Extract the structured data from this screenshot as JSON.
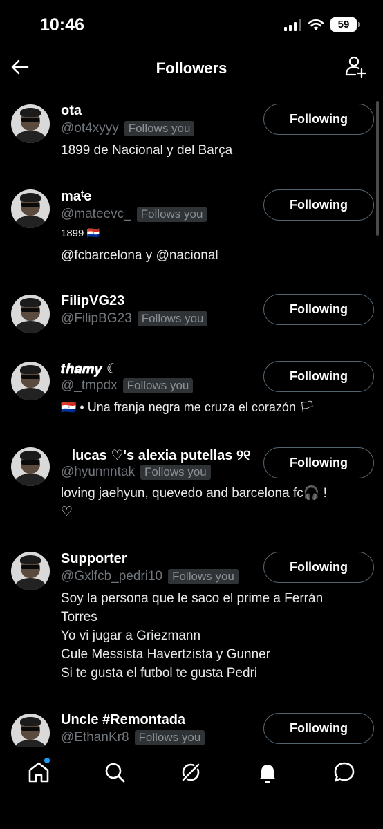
{
  "status": {
    "time": "10:46",
    "battery": "59"
  },
  "header": {
    "title": "Followers"
  },
  "followers": [
    {
      "name": "ota",
      "handle": "@ot4xyyy",
      "badge": "Follows you",
      "bio": [
        "1899 de Nacional y del Barça"
      ],
      "button": "Following"
    },
    {
      "name": "maᵗe",
      "handle": "@mateevc_",
      "badge": "Follows you",
      "bio_small": "1899 🇵🇾",
      "bio": [
        "@fcbarcelona y @nacional"
      ],
      "button": "Following"
    },
    {
      "name": "FilipVG23",
      "handle": "@FilipBG23",
      "badge": "Follows you",
      "bio": [],
      "button": "Following"
    },
    {
      "name": "𝒕𝒉𝒂𝒎𝒚 ☾",
      "handle": "@_tmpdx",
      "badge": "Follows you",
      "bio": [
        "🇵🇾 • Una franja negra me cruza el corazón 🏳"
      ],
      "button": "Following"
    },
    {
      "name": "⠀lucas ♡'s alexia putellas ୨୧",
      "handle": "@hyunnntak",
      "badge": "Follows you",
      "bio": [
        "loving jaehyun, quevedo and barcelona fc🎧 !",
        "♡"
      ],
      "button": "Following"
    },
    {
      "name": "Supporter",
      "handle": "@Gxlfcb_pedri10",
      "badge": "Follows you",
      "bio": [
        "Soy la persona que le saco el prime a Ferrán",
        "Torres",
        "Yo vi jugar a Griezmann",
        "Cule Messista Havertzista y Gunner",
        "Si te gusta el futbol te gusta Pedri"
      ],
      "button": "Following"
    },
    {
      "name": "Uncle #Remontada",
      "handle": "@EthanKr8",
      "badge": "Follows you",
      "bio": [],
      "button": "Following"
    }
  ],
  "nav": {
    "items": [
      "home-icon",
      "search-icon",
      "grok-icon",
      "notifications-icon",
      "messages-icon"
    ]
  }
}
